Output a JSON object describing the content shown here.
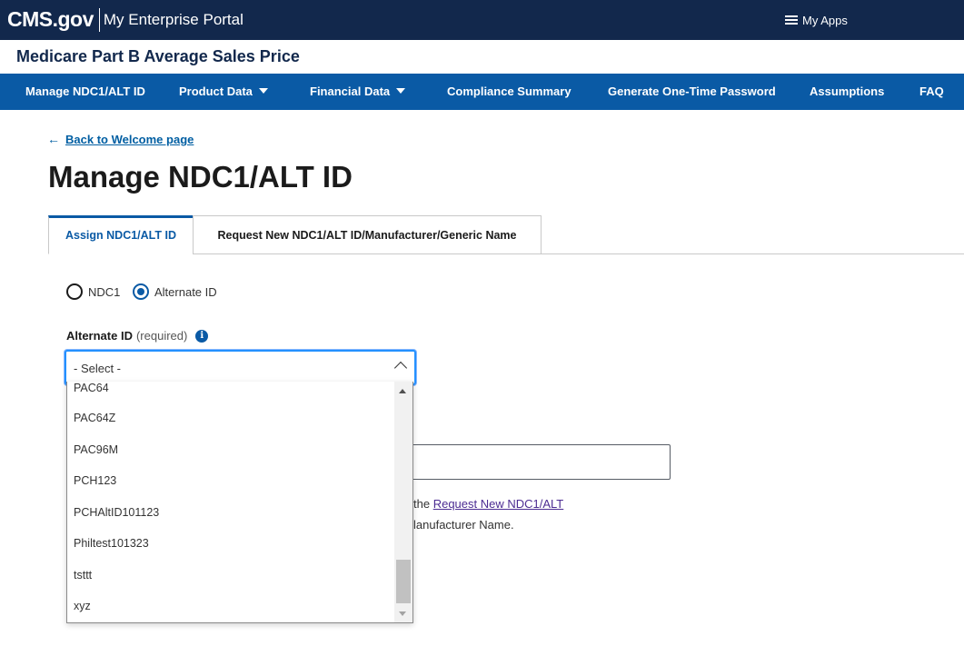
{
  "header": {
    "logo_text": "CMS.gov",
    "portal_name": "My Enterprise Portal",
    "my_apps": "My Apps"
  },
  "app_title": "Medicare Part B Average Sales Price",
  "nav": {
    "items": [
      {
        "label": "Manage NDC1/ALT ID"
      },
      {
        "label": "Product Data"
      },
      {
        "label": "Financial Data"
      },
      {
        "label": "Compliance Summary"
      },
      {
        "label": "Generate One-Time Password"
      },
      {
        "label": "Assumptions"
      },
      {
        "label": "FAQ"
      }
    ]
  },
  "back_link": "Back to Welcome page",
  "page_title": "Manage NDC1/ALT ID",
  "tabs": [
    {
      "label": "Assign NDC1/ALT ID",
      "active": true
    },
    {
      "label": "Request New NDC1/ALT ID/Manufacturer/Generic Name",
      "active": false
    }
  ],
  "radios": {
    "ndc1": "NDC1",
    "alternate_id": "Alternate ID",
    "selected": "Alternate ID"
  },
  "field": {
    "label": "Alternate ID",
    "required": "(required)",
    "info_icon": "i",
    "select_value": "- Select -"
  },
  "dropdown_options": [
    "PAC64",
    "PAC64Z",
    "PAC96M",
    "PCH123",
    "PCHAltID101123",
    "Philtest101323",
    "tsttt",
    "xyz"
  ],
  "hint": {
    "line1_prefix": "the",
    "line1_link": "Request New NDC1/ALT",
    "line2": "lanufacturer Name."
  },
  "colors": {
    "top_bar": "#12284c",
    "nav_bar": "#0a5aa5",
    "link": "#005ea2",
    "focus": "#2491ff"
  }
}
